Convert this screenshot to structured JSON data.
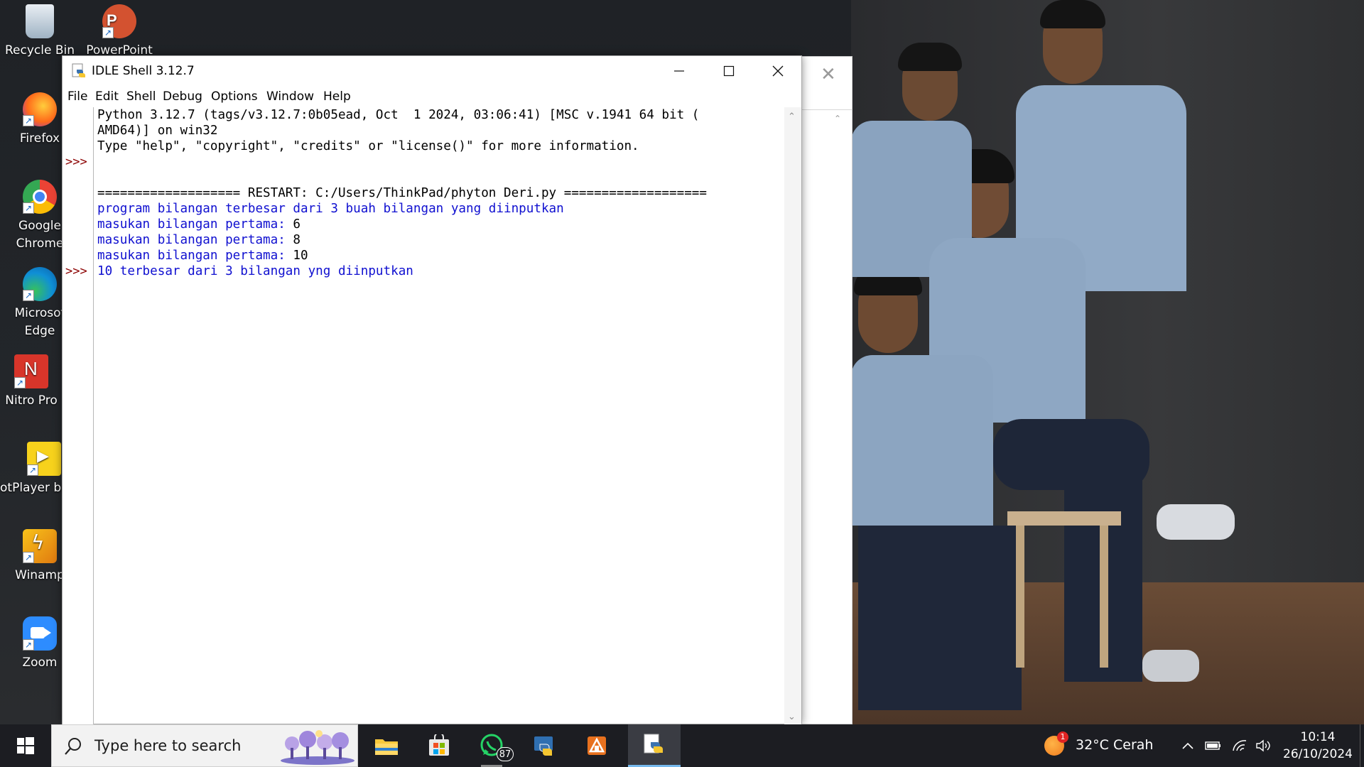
{
  "desktop": {
    "icons": [
      {
        "name": "recycle-bin",
        "label": "Recycle Bin"
      },
      {
        "name": "powerpoint",
        "label": "PowerPoint"
      },
      {
        "name": "firefox",
        "label": "Firefox"
      },
      {
        "name": "google-chrome",
        "label": "Google Chrome"
      },
      {
        "name": "microsoft-edge",
        "label": "Microsof Edge"
      },
      {
        "name": "nitro-pro",
        "label": "Nitro Pro"
      },
      {
        "name": "potplayer",
        "label": "PotPlayer bit"
      },
      {
        "name": "winamp",
        "label": "Winamp"
      },
      {
        "name": "zoom",
        "label": "Zoom"
      }
    ]
  },
  "window": {
    "title": "IDLE Shell 3.12.7",
    "menu": [
      "File",
      "Edit",
      "Shell",
      "Debug",
      "Options",
      "Window",
      "Help"
    ],
    "prompt_symbol": ">>>",
    "lines": [
      {
        "text": "Python 3.12.7 (tags/v3.12.7:0b05ead, Oct  1 2024, 03:06:41) [MSC v.1941 64 bit (",
        "color": "black"
      },
      {
        "text": "AMD64)] on win32",
        "color": "black"
      },
      {
        "text": "Type \"help\", \"copyright\", \"credits\" or \"license()\" for more information.",
        "color": "black"
      },
      {
        "text": "",
        "color": "black"
      },
      {
        "text": "=================== RESTART: C:/Users/ThinkPad/phyton Deri.py ===================",
        "color": "black"
      },
      {
        "text": "program bilangan terbesar dari 3 buah bilangan yang diinputkan",
        "color": "blue"
      },
      {
        "text": "masukan bilangan pertama: ",
        "color": "blue",
        "input": "6"
      },
      {
        "text": "masukan bilangan pertama: ",
        "color": "blue",
        "input": "8"
      },
      {
        "text": "masukan bilangan pertama: ",
        "color": "blue",
        "input": "10"
      },
      {
        "text": "10 terbesar dari 3 bilangan yng diinputkan",
        "color": "blue"
      }
    ]
  },
  "taskbar": {
    "search_placeholder": "Type here to search",
    "apps": [
      "file-explorer",
      "microsoft-store",
      "whatsapp",
      "python",
      "office-app",
      "idle"
    ],
    "whatsapp_badge": "87",
    "weather_badge": "1",
    "weather": "32°C  Cerah",
    "time": "10:14",
    "date": "26/10/2024"
  },
  "colors": {
    "prompt": "#8b0000",
    "output_blue": "#1010d0",
    "taskbar": "#1c1d22"
  }
}
